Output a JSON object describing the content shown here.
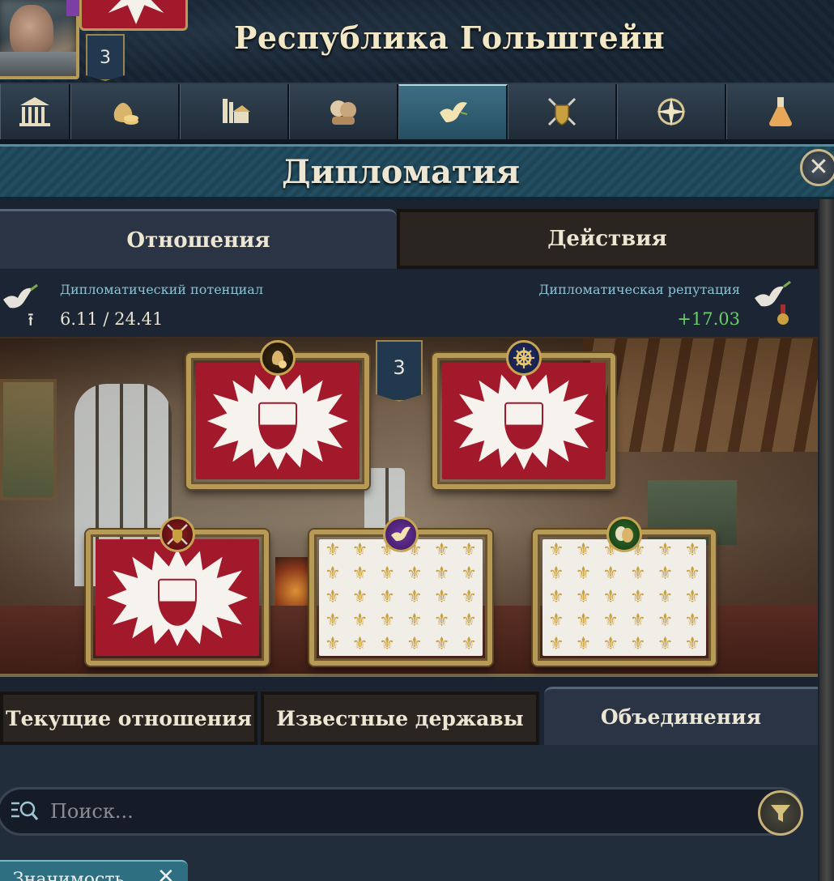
{
  "header": {
    "realm_title": "Республика Гольштейн",
    "rank": "3"
  },
  "nav_tabs": [
    {
      "icon": "government-icon",
      "active": false
    },
    {
      "icon": "treasury-icon",
      "active": false
    },
    {
      "icon": "buildings-icon",
      "active": false
    },
    {
      "icon": "politics-icon",
      "active": false
    },
    {
      "icon": "diplomacy-dove-icon",
      "active": true
    },
    {
      "icon": "military-icon",
      "active": false
    },
    {
      "icon": "exploration-compass-icon",
      "active": false
    },
    {
      "icon": "technology-flask-icon",
      "active": false
    }
  ],
  "panel": {
    "title": "Дипломатия",
    "close_symbol": "✕"
  },
  "subtabs": {
    "relations": "Отношения",
    "actions": "Действия"
  },
  "stats": {
    "potential_label": "Дипломатический потенциал",
    "potential_value": "6.11 / 24.41",
    "reputation_label": "Дипломатическая репутация",
    "reputation_value": "+17.03",
    "reputation_color": "#6ad06a"
  },
  "diplomats": {
    "count": "3",
    "slots": [
      {
        "flag": "red-white-burst",
        "role_icon": "money-bag-icon"
      },
      {
        "flag": "red-white-burst",
        "role_icon": "ship-wheel-icon"
      },
      {
        "flag": "red-white-burst",
        "role_icon": "crossed-swords-shield-icon"
      },
      {
        "flag": "fleur-de-lis",
        "role_icon": "dove-icon"
      },
      {
        "flag": "fleur-de-lis",
        "role_icon": "theater-masks-icon"
      }
    ]
  },
  "bottom_tabs": {
    "current": "Текущие отношения",
    "known": "Известные державы",
    "unions": "Объединения"
  },
  "search": {
    "placeholder": "Поиск..."
  },
  "sort_chip": {
    "label": "Значимость",
    "remove_symbol": "✕"
  },
  "colors": {
    "accent_gold": "#b89a57",
    "active_tab": "#3e6e84",
    "flag_red": "#a2192b",
    "fleur_gold": "#c9a040"
  }
}
